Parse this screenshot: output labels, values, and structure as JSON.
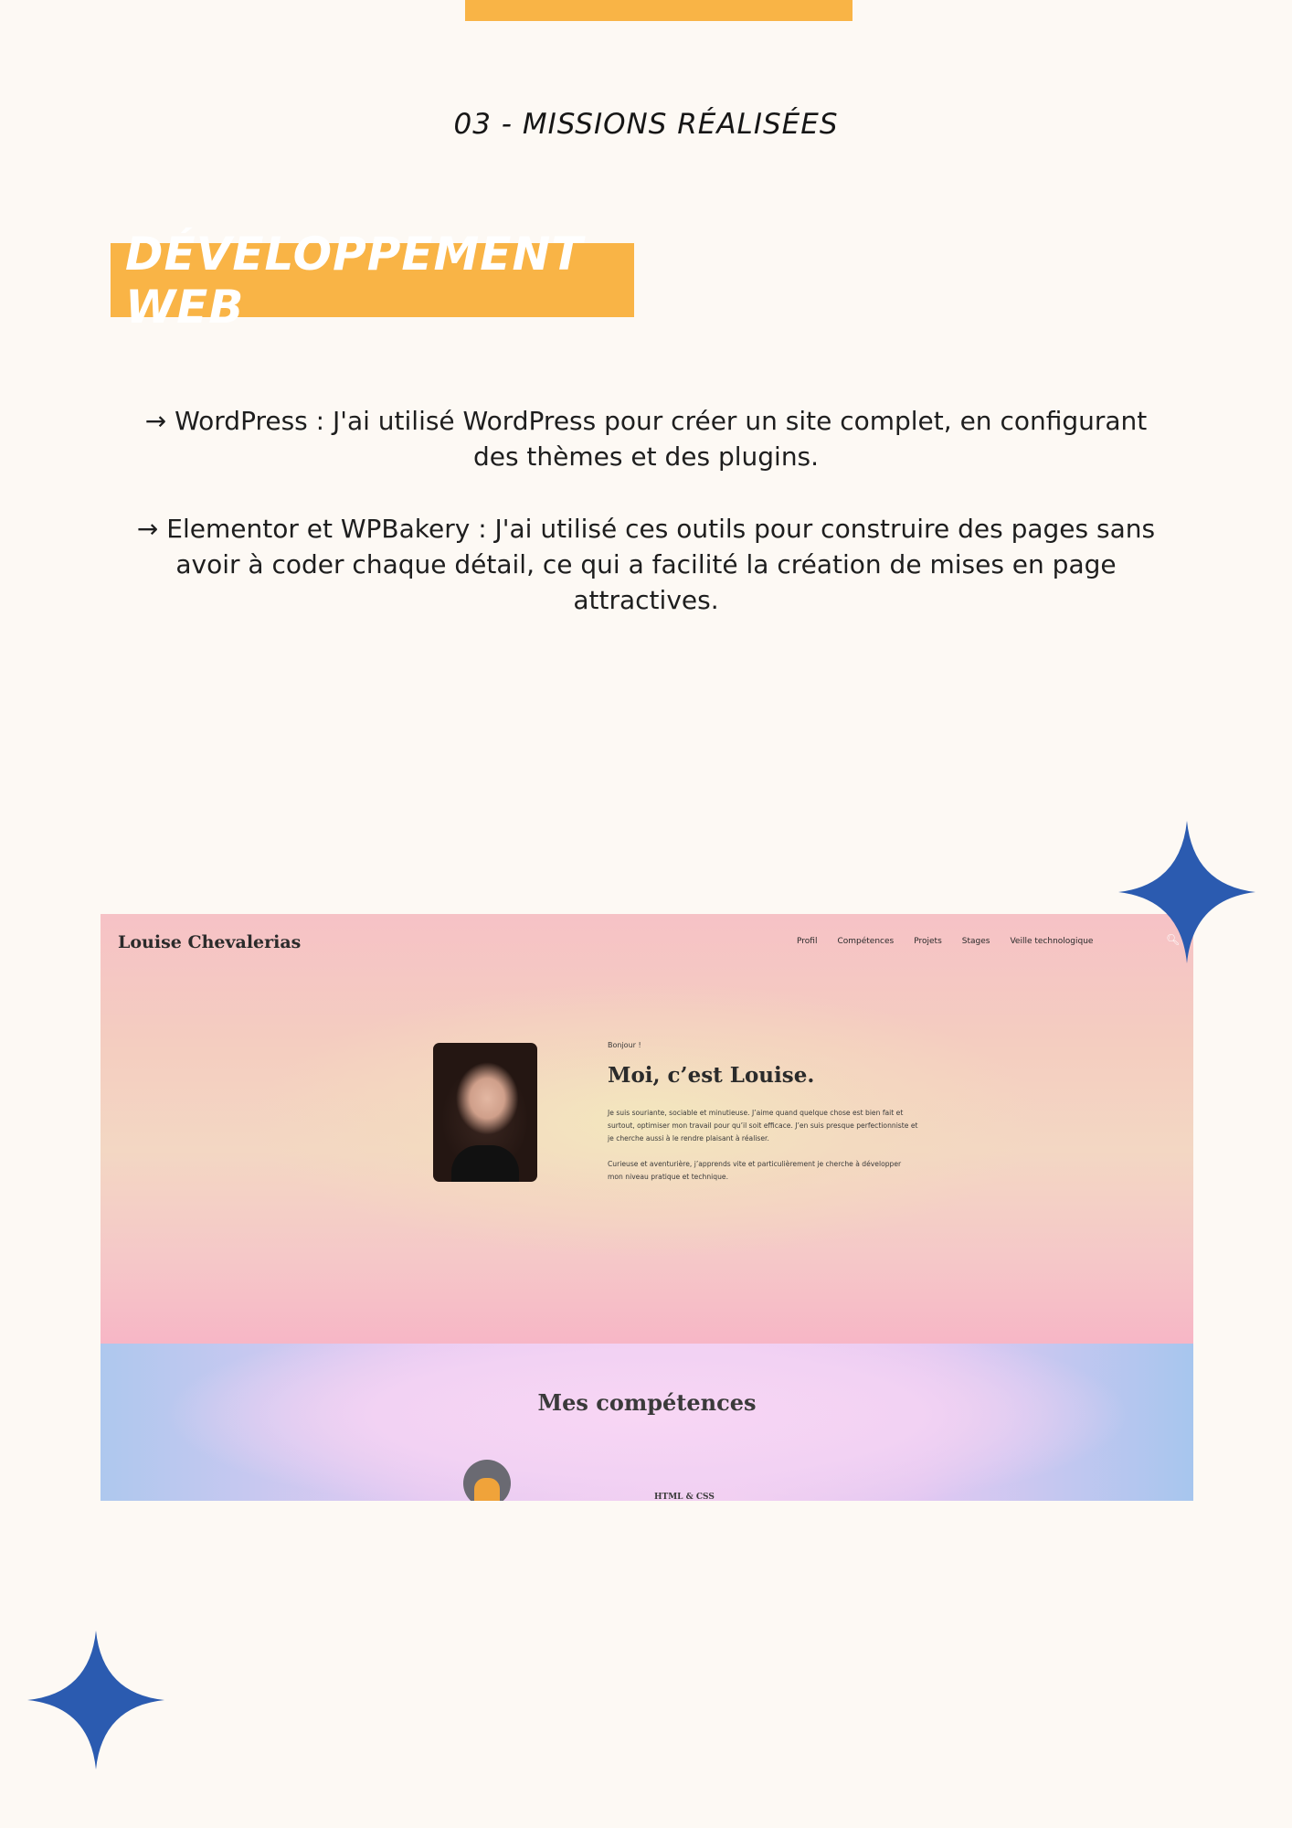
{
  "section": {
    "number_label": "03 - MISSIONS RÉALISÉES"
  },
  "title": {
    "text": "DÉVELOPPEMENT WEB"
  },
  "paragraphs": [
    "→ WordPress : J'ai utilisé WordPress pour créer un site complet, en configurant des thèmes et des plugins.",
    "→ Elementor et WPBakery : J'ai utilisé ces outils pour construire des pages sans avoir à coder chaque détail, ce qui a facilité la création de mises en page attractives."
  ],
  "screenshot": {
    "site_name": "Louise Chevalerias",
    "nav": [
      "Profil",
      "Compétences",
      "Projets",
      "Stages",
      "Veille technologique"
    ],
    "search_icon": "search-icon",
    "greeting": "Bonjour !",
    "heading": "Moi, c’est Louise.",
    "intro_1": "Je suis souriante, sociable et minutieuse. J’aime quand quelque chose est bien fait et surtout, optimiser mon travail pour qu’il soit efficace. J’en suis presque perfectionniste et je cherche aussi à le rendre plaisant à réaliser.",
    "intro_2": "Curieuse et aventurière, j’apprends vite et particulièrement je cherche à développer mon niveau pratique et technique.",
    "skills_title": "Mes compétences",
    "skill_label": "HTML & CSS"
  },
  "colors": {
    "accent": "#f9b446",
    "star": "#2b5bb0",
    "background": "#fdf9f4"
  }
}
